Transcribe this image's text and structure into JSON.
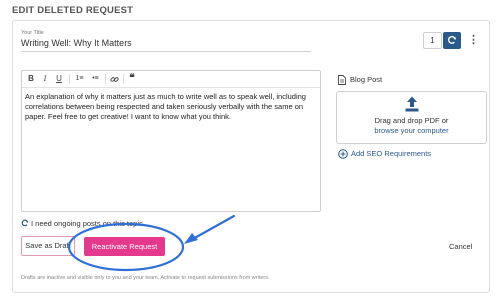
{
  "page": {
    "title": "EDIT DELETED REQUEST"
  },
  "form": {
    "title_label": "Your Title",
    "title_value": "Writing Well: Why It Matters",
    "version": "1",
    "more_icon": "⋮"
  },
  "toolbar": {
    "buttons": [
      {
        "name": "bold-icon",
        "glyph": "B"
      },
      {
        "name": "italic-icon",
        "glyph": "I"
      },
      {
        "name": "underline-icon",
        "glyph": "U"
      },
      {
        "name": "ordered-list-icon",
        "glyph": "1≡"
      },
      {
        "name": "bullet-list-icon",
        "glyph": "•≡"
      },
      {
        "name": "link-icon",
        "glyph": "🔗"
      },
      {
        "name": "quote-icon",
        "glyph": "❝"
      }
    ]
  },
  "editor": {
    "body": "An explanation of why it matters just as much to write well as to speak well, including correlations between being respected and taken seriously verbally with the same on paper. Feel free to get creative! I want to know what you think."
  },
  "sidebar": {
    "blog_post_label": "Blog Post",
    "dropzone_text": "Drag and drop PDF or",
    "dropzone_link": "browse your computer",
    "seo_link": "Add SEO Requirements"
  },
  "options": {
    "ongoing_label": "I need ongoing posts on this topic"
  },
  "actions": {
    "save_draft": "Save as Draft",
    "reactivate": "Reactivate Request",
    "cancel": "Cancel"
  },
  "footer": {
    "note": "Drafts are inactive and visible only to you and your team. Activate to request submissions from writers."
  },
  "colors": {
    "accent_blue": "#2b5a8a",
    "primary_pink": "#e4398c",
    "annotation_blue": "#2f6fd6"
  }
}
